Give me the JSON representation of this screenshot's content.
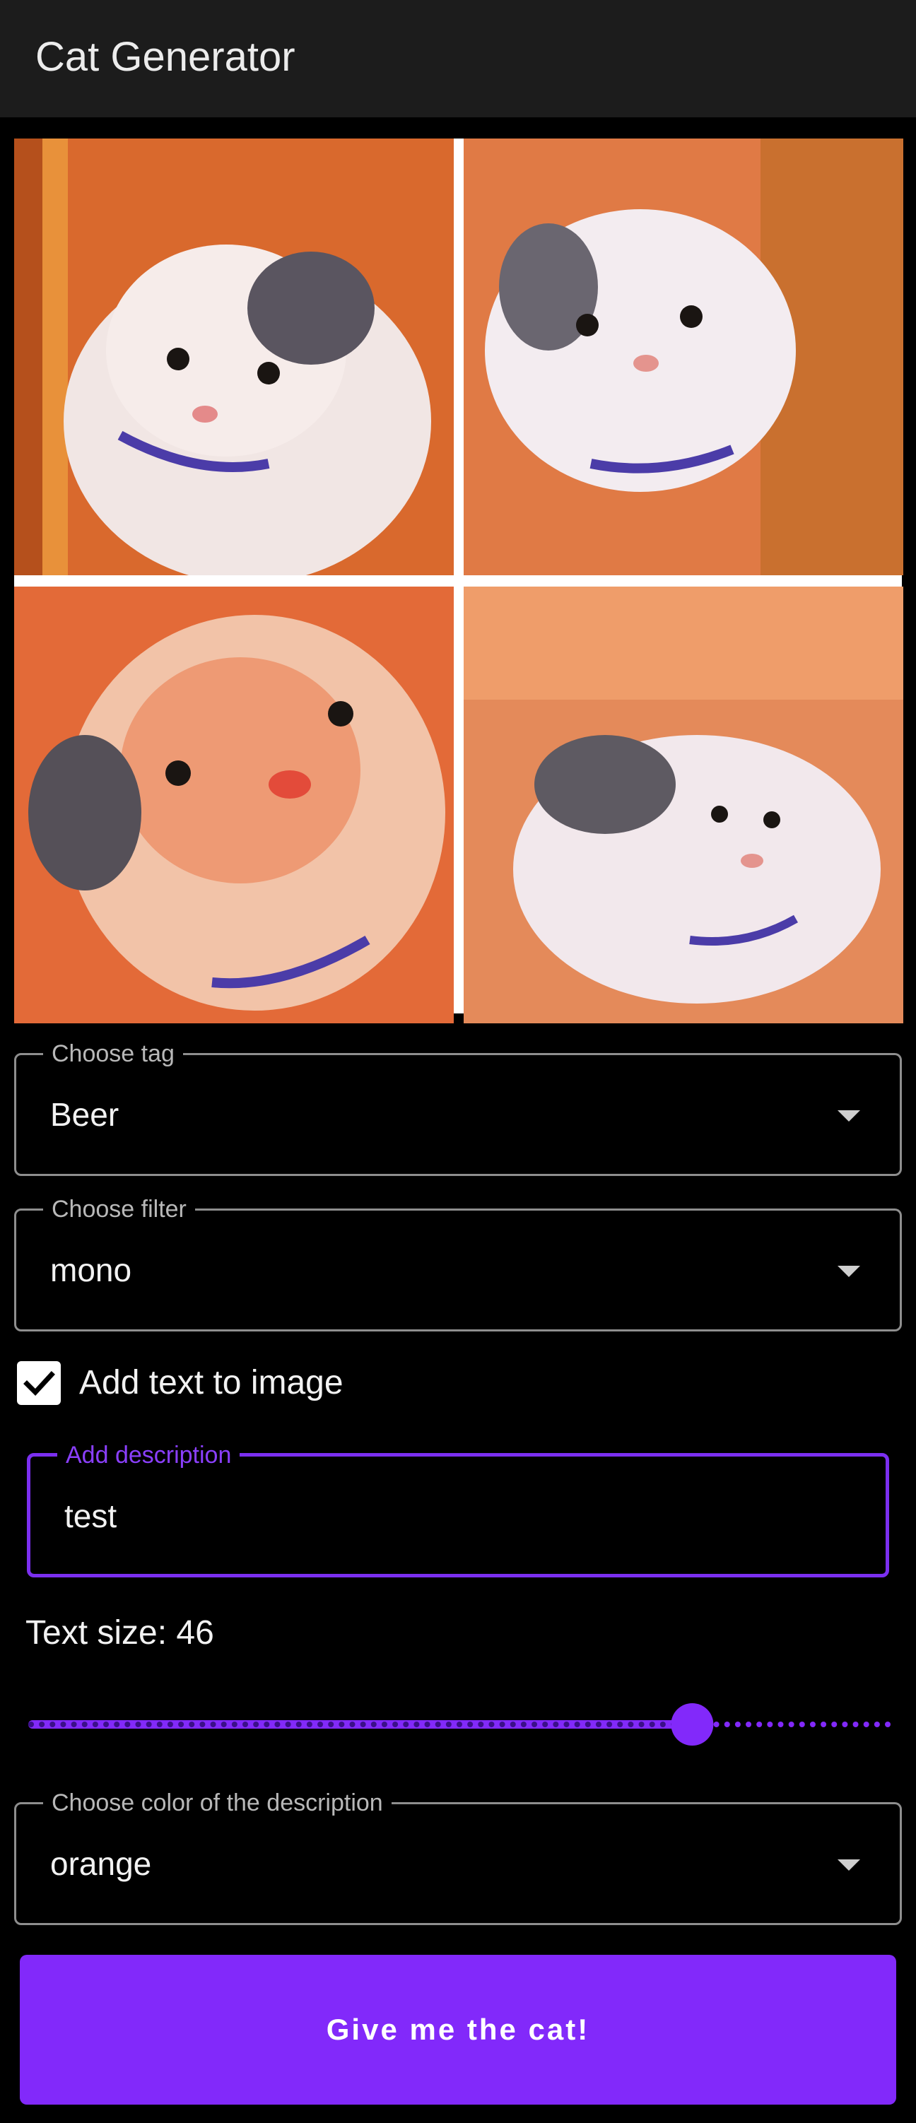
{
  "app": {
    "title": "Cat Generator"
  },
  "collage": {
    "images": [
      {
        "name": "kitten-photo-1"
      },
      {
        "name": "kitten-photo-2"
      },
      {
        "name": "kitten-photo-3"
      },
      {
        "name": "kitten-photo-4"
      }
    ]
  },
  "tag_select": {
    "label": "Choose tag",
    "value": "Beer",
    "icon": "arrow-drop-down-icon"
  },
  "filter_select": {
    "label": "Choose filter",
    "value": "mono",
    "icon": "arrow-drop-down-icon"
  },
  "add_text": {
    "label": "Add text to image",
    "checked": true,
    "icon": "check-icon"
  },
  "description": {
    "label": "Add description",
    "value": "test"
  },
  "text_size": {
    "label": "Text size: 46",
    "value": 46,
    "min_fraction": 0.0,
    "position_fraction": 0.77
  },
  "color_select": {
    "label": "Choose color of the description",
    "value": "orange",
    "icon": "arrow-drop-down-icon"
  },
  "submit": {
    "label": "Give me the cat!"
  },
  "colors": {
    "accent": "#8229fa",
    "focus_outline": "#7b2ff0",
    "appbar": "#1c1c1c",
    "background": "#000000"
  }
}
